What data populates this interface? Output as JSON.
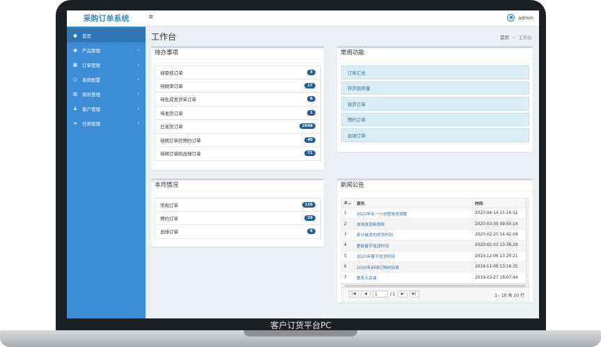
{
  "caption": "客户订货平台PC",
  "app": {
    "title": "采购订单系统"
  },
  "topbar": {
    "menu_glyph": "≡",
    "username": "admin"
  },
  "sidebar": {
    "items": [
      {
        "label": "首页",
        "icon": "home-icon",
        "glyph": "●",
        "active": true,
        "chevron": ""
      },
      {
        "label": "产品管理",
        "icon": "product-icon",
        "glyph": "◉",
        "chevron": "‹"
      },
      {
        "label": "订单管理",
        "icon": "calendar-icon",
        "glyph": "▦",
        "chevron": "‹"
      },
      {
        "label": "系统配置",
        "icon": "circle-icon",
        "glyph": "○",
        "chevron": "‹"
      },
      {
        "label": "资讯管理",
        "icon": "list-icon",
        "glyph": "▤",
        "chevron": "‹"
      },
      {
        "label": "客户管理",
        "icon": "users-icon",
        "glyph": "♟",
        "chevron": "‹"
      },
      {
        "label": "任务管理",
        "icon": "signin-icon",
        "glyph": "➜",
        "chevron": "‹"
      }
    ]
  },
  "page": {
    "title": "工作台",
    "breadcrumb": [
      "首页",
      "工作台"
    ],
    "breadcrumb_sep": ">"
  },
  "todo": {
    "title": "待办事项",
    "items": [
      {
        "label": "待审核订单",
        "count": "3"
      },
      {
        "label": "待财审订单",
        "count": "17"
      },
      {
        "label": "待生成发货单订单",
        "count": "6"
      },
      {
        "label": "待发货订单",
        "count": "1"
      },
      {
        "label": "已发货订单",
        "count": "2048"
      },
      {
        "label": "待转订单的预约订单",
        "count": "40"
      },
      {
        "label": "待转订单的血球订单",
        "count": "71"
      }
    ]
  },
  "functions": {
    "title": "常用功能",
    "items": [
      "订单汇总",
      "存货现存量",
      "现货订单",
      "预约订单",
      "血球订单"
    ]
  },
  "month": {
    "title": "本月情况",
    "items": [
      {
        "label": "常规订单",
        "count": "126"
      },
      {
        "label": "预约订单",
        "count": "29"
      },
      {
        "label": "血球订单",
        "count": "9"
      }
    ]
  },
  "news": {
    "title": "新闻公告",
    "columns": [
      "#…",
      "资讯",
      "时间"
    ],
    "rows": [
      {
        "no": "1",
        "title": "2020年五一小长假发货调整",
        "time": "2020-04-14 15:16:12"
      },
      {
        "no": "2",
        "title": "血球发货新规则",
        "time": "2020-03-30 09:55:14"
      },
      {
        "no": "3",
        "title": "部分缺货的供货时间",
        "time": "2020-02-20 14:42:04"
      },
      {
        "no": "4",
        "title": "更新春节发货时间",
        "time": "2020-02-03 13:36:29"
      },
      {
        "no": "5",
        "title": "2020年春节发货时间",
        "time": "2019-12-06 13:20:21"
      },
      {
        "no": "6",
        "title": "2020年血球订购时间表",
        "time": "2019-11-06 13:14:35"
      },
      {
        "no": "7",
        "title": "联系人目录",
        "time": "2019-03-27 16:07:44"
      }
    ],
    "pager": {
      "page": "1",
      "of": "/ 1",
      "info": "1 - 10 共 10 行"
    }
  }
}
